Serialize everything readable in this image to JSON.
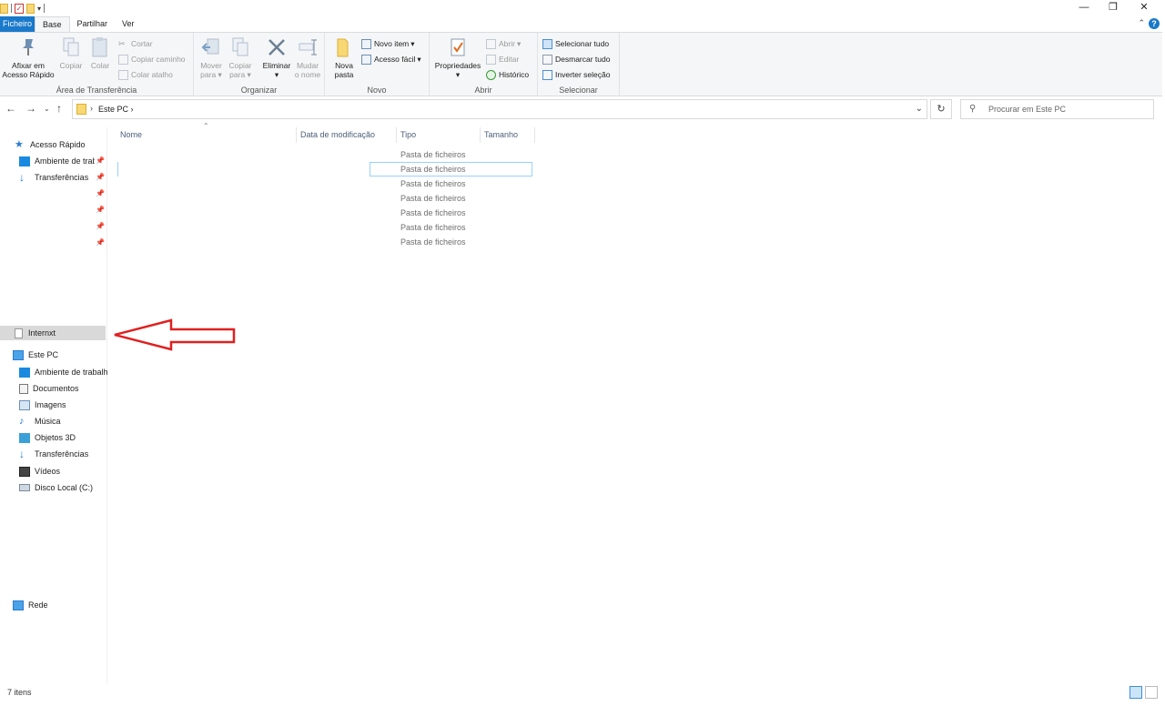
{
  "window": {
    "minimize": "—",
    "restore": "❐",
    "close": "✕"
  },
  "ribbon_tabs": [
    {
      "label": "Ficheiro"
    },
    {
      "label": "Base"
    },
    {
      "label": "Partilhar"
    },
    {
      "label": "Ver"
    }
  ],
  "help": "?",
  "clipboard": {
    "pin_label_1": "Afixar em",
    "pin_label_2": "Acesso Rápido",
    "copy": "Copiar",
    "paste": "Colar",
    "cut": "Cortar",
    "copy_path": "Copiar caminho",
    "paste_shortcut": "Colar atalho",
    "group": "Área de Transferência"
  },
  "organize": {
    "move_1": "Mover",
    "move_2": "para",
    "copyto_1": "Copiar",
    "copyto_2": "para",
    "delete": "Eliminar",
    "rename_1": "Mudar",
    "rename_2": "o nome",
    "group": "Organizar"
  },
  "new": {
    "folder_1": "Nova",
    "folder_2": "pasta",
    "new_item": "Novo item",
    "easy_access": "Acesso fácil",
    "group": "Novo"
  },
  "open": {
    "properties": "Propriedades",
    "open": "Abrir",
    "edit": "Editar",
    "history": "Histórico",
    "group": "Abrir"
  },
  "select": {
    "select_all": "Selecionar tudo",
    "select_none": "Desmarcar tudo",
    "invert": "Inverter seleção",
    "group": "Selecionar"
  },
  "address": {
    "crumb": "Este PC",
    "search_placeholder": "Procurar em Este PC"
  },
  "nav": {
    "quick_access": "Acesso Rápido",
    "qa_desktop": "Ambiente de trabalho",
    "qa_downloads": "Transferências",
    "internxt": "Internxt",
    "this_pc": "Este PC",
    "pc_desktop": "Ambiente de trabalho",
    "pc_documents": "Documentos",
    "pc_pictures": "Imagens",
    "pc_music": "Música",
    "pc_3d": "Objetos 3D",
    "pc_downloads": "Transferências",
    "pc_videos": "Vídeos",
    "pc_disk": "Disco Local (C:)",
    "network": "Rede"
  },
  "columns": {
    "name": "Nome",
    "modified": "Data de modificação",
    "type": "Tipo",
    "size": "Tamanho"
  },
  "rows": [
    {
      "type": "Pasta de ficheiros"
    },
    {
      "type": "Pasta de ficheiros"
    },
    {
      "type": "Pasta de ficheiros"
    },
    {
      "type": "Pasta de ficheiros"
    },
    {
      "type": "Pasta de ficheiros"
    },
    {
      "type": "Pasta de ficheiros"
    },
    {
      "type": "Pasta de ficheiros"
    }
  ],
  "status": {
    "count": "7 itens"
  },
  "colors": {
    "accent": "#1979ca",
    "arrow": "#e02020",
    "selected_nav": "#d9d9d9"
  }
}
